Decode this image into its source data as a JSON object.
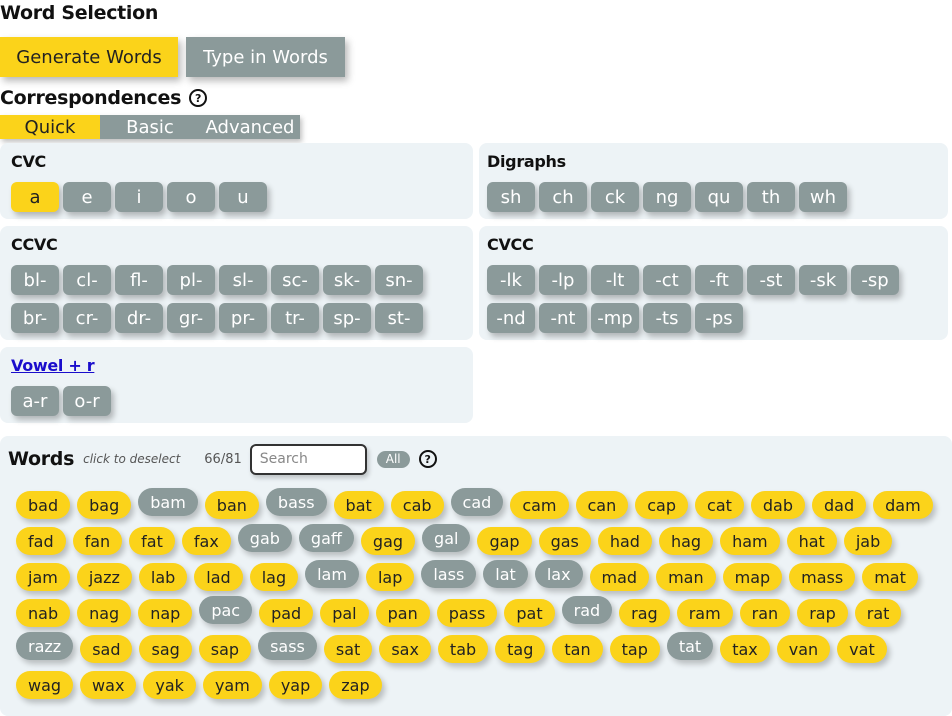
{
  "title": "Word Selection",
  "modes": [
    "Generate Words",
    "Type in Words"
  ],
  "correspondences": {
    "heading": "Correspondences",
    "help": "?",
    "tabs": [
      "Quick",
      "Basic",
      "Advanced"
    ]
  },
  "groups": [
    {
      "title": "CVC",
      "items": [
        "a",
        "e",
        "i",
        "o",
        "u"
      ],
      "selected": [
        "a"
      ]
    },
    {
      "title": "Digraphs",
      "items": [
        "sh",
        "ch",
        "ck",
        "ng",
        "qu",
        "th",
        "wh"
      ],
      "selected": []
    },
    {
      "title": "CCVC",
      "items": [
        "bl-",
        "cl-",
        "fl-",
        "pl-",
        "sl-",
        "sc-",
        "sk-",
        "sn-",
        "br-",
        "cr-",
        "dr-",
        "gr-",
        "pr-",
        "tr-",
        "sp-",
        "st-"
      ],
      "selected": []
    },
    {
      "title": "CVCC",
      "items": [
        "-lk",
        "-lp",
        "-lt",
        "-ct",
        "-ft",
        "-st",
        "-sk",
        "-sp",
        "-nd",
        "-nt",
        "-mp",
        "-ts",
        "-ps"
      ],
      "selected": []
    },
    {
      "title": "Vowel + r",
      "items": [
        "a-r",
        "o-r"
      ],
      "selected": []
    }
  ],
  "words": {
    "label": "Words",
    "hint": "click to deselect",
    "count": "66/81",
    "search_placeholder": "Search",
    "all_label": "All",
    "help": "?",
    "list": [
      {
        "w": "bad",
        "on": true
      },
      {
        "w": "bag",
        "on": true
      },
      {
        "w": "bam",
        "on": false
      },
      {
        "w": "ban",
        "on": true
      },
      {
        "w": "bass",
        "on": false
      },
      {
        "w": "bat",
        "on": true
      },
      {
        "w": "cab",
        "on": true
      },
      {
        "w": "cad",
        "on": false
      },
      {
        "w": "cam",
        "on": true
      },
      {
        "w": "can",
        "on": true
      },
      {
        "w": "cap",
        "on": true
      },
      {
        "w": "cat",
        "on": true
      },
      {
        "w": "dab",
        "on": true
      },
      {
        "w": "dad",
        "on": true
      },
      {
        "w": "dam",
        "on": true
      },
      {
        "w": "fad",
        "on": true
      },
      {
        "w": "fan",
        "on": true
      },
      {
        "w": "fat",
        "on": true
      },
      {
        "w": "fax",
        "on": true
      },
      {
        "w": "gab",
        "on": false
      },
      {
        "w": "gaff",
        "on": false
      },
      {
        "w": "gag",
        "on": true
      },
      {
        "w": "gal",
        "on": false
      },
      {
        "w": "gap",
        "on": true
      },
      {
        "w": "gas",
        "on": true
      },
      {
        "w": "had",
        "on": true
      },
      {
        "w": "hag",
        "on": true
      },
      {
        "w": "ham",
        "on": true
      },
      {
        "w": "hat",
        "on": true
      },
      {
        "w": "jab",
        "on": true
      },
      {
        "w": "jam",
        "on": true
      },
      {
        "w": "jazz",
        "on": true
      },
      {
        "w": "lab",
        "on": true
      },
      {
        "w": "lad",
        "on": true
      },
      {
        "w": "lag",
        "on": true
      },
      {
        "w": "lam",
        "on": false
      },
      {
        "w": "lap",
        "on": true
      },
      {
        "w": "lass",
        "on": false
      },
      {
        "w": "lat",
        "on": false
      },
      {
        "w": "lax",
        "on": false
      },
      {
        "w": "mad",
        "on": true
      },
      {
        "w": "man",
        "on": true
      },
      {
        "w": "map",
        "on": true
      },
      {
        "w": "mass",
        "on": true
      },
      {
        "w": "mat",
        "on": true
      },
      {
        "w": "nab",
        "on": true
      },
      {
        "w": "nag",
        "on": true
      },
      {
        "w": "nap",
        "on": true
      },
      {
        "w": "pac",
        "on": false
      },
      {
        "w": "pad",
        "on": true
      },
      {
        "w": "pal",
        "on": true
      },
      {
        "w": "pan",
        "on": true
      },
      {
        "w": "pass",
        "on": true
      },
      {
        "w": "pat",
        "on": true
      },
      {
        "w": "rad",
        "on": false
      },
      {
        "w": "rag",
        "on": true
      },
      {
        "w": "ram",
        "on": true
      },
      {
        "w": "ran",
        "on": true
      },
      {
        "w": "rap",
        "on": true
      },
      {
        "w": "rat",
        "on": true
      },
      {
        "w": "razz",
        "on": false
      },
      {
        "w": "sad",
        "on": true
      },
      {
        "w": "sag",
        "on": true
      },
      {
        "w": "sap",
        "on": true
      },
      {
        "w": "sass",
        "on": false
      },
      {
        "w": "sat",
        "on": true
      },
      {
        "w": "sax",
        "on": true
      },
      {
        "w": "tab",
        "on": true
      },
      {
        "w": "tag",
        "on": true
      },
      {
        "w": "tan",
        "on": true
      },
      {
        "w": "tap",
        "on": true
      },
      {
        "w": "tat",
        "on": false
      },
      {
        "w": "tax",
        "on": true
      },
      {
        "w": "van",
        "on": true
      },
      {
        "w": "vat",
        "on": true
      },
      {
        "w": "wag",
        "on": true
      },
      {
        "w": "wax",
        "on": true
      },
      {
        "w": "yak",
        "on": true
      },
      {
        "w": "yam",
        "on": true
      },
      {
        "w": "yap",
        "on": true
      },
      {
        "w": "zap",
        "on": true
      }
    ]
  },
  "colors": {
    "selected": "#fbd31a",
    "unselected": "#8b9a9a",
    "panel": "#edf3f6",
    "link": "#1a0dcc"
  }
}
